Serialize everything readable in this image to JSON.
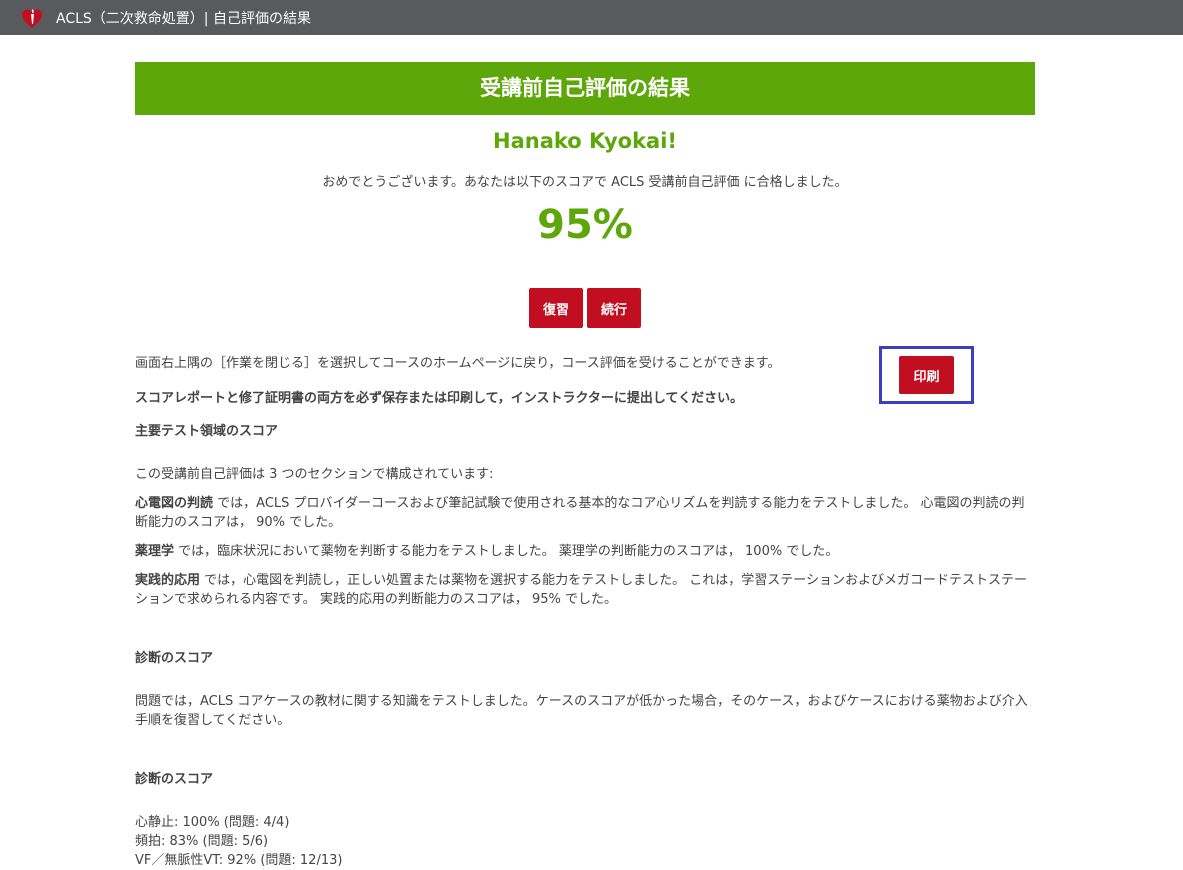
{
  "window": {
    "title": "ACLS（二次救命処置）| 自己評価の結果",
    "logo_icon": "heart-torch-logo",
    "brand_color": "#c10e21",
    "titlebar_color": "#595a5e"
  },
  "banner": {
    "text": "受講前自己評価の結果",
    "color": "#5ea70b"
  },
  "user": {
    "name": "Hanako Kyokai!"
  },
  "congrats": "おめでとうございます。あなたは以下のスコアで ACLS 受講前自己評価 に合格しました。",
  "score": "95%",
  "buttons": {
    "review": "復習",
    "continue": "続行",
    "print": "印刷"
  },
  "info": {
    "close_note": "画面右上隅の［作業を閉じる］を選択してコースのホームページに戻り，コース評価を受けることができます。",
    "save_note": "スコアレポートと修了証明書の両方を必ず保存または印刷して，インストラクターに提出してください。"
  },
  "main_areas": {
    "heading": "主要テスト領域のスコア",
    "intro": "この受講前自己評価は 3 つのセクションで構成されています:",
    "items": [
      {
        "term": "心電図の判読",
        "text": " では，ACLS プロバイダーコースおよび筆記試験で使用される基本的なコア心リズムを判読する能力をテストしました。 心電図の判読の判断能力のスコアは， 90% でした。"
      },
      {
        "term": "薬理学",
        "text": " では，臨床状況において薬物を判断する能力をテストしました。 薬理学の判断能力のスコアは， 100% でした。"
      },
      {
        "term": "実践的応用",
        "text": " では，心電図を判読し，正しい処置または薬物を選択する能力をテストしました。 これは，学習ステーションおよびメガコードテストステーションで求められる内容です。 実践的応用の判断能力のスコアは， 95% でした。"
      }
    ]
  },
  "diagnosis": {
    "heading": "診断のスコア",
    "text": "問題では，ACLS コアケースの教材に関する知識をテストしました。ケースのスコアが低かった場合，そのケース，およびケースにおける薬物および介入手順を復習してください。"
  },
  "diagnosis_scores": {
    "heading": "診断のスコア",
    "items": [
      "心静止: 100% (問題: 4/4)",
      "頻拍: 83% (問題: 5/6)",
      "VF／無脈性VT: 92% (問題: 12/13)"
    ]
  }
}
